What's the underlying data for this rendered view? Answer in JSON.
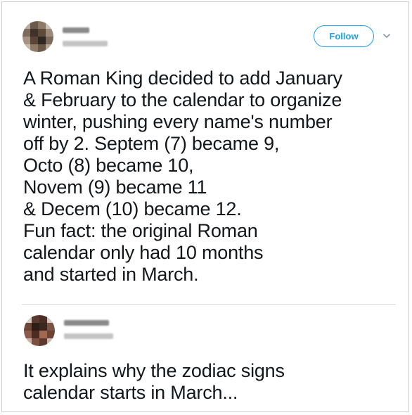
{
  "tweet": {
    "follow_label": "Follow",
    "text_lines": [
      "A Roman King decided to add January",
      "& February to the calendar to organize",
      "winter, pushing every name's number",
      "off by 2. Septem (7) became 9,",
      "Octo (8) became 10,",
      "Novem (9) became 11",
      "& Decem (10) became 12.",
      "Fun fact: the original Roman",
      "calendar only had 10 months",
      "and started in March."
    ]
  },
  "reply": {
    "text_lines": [
      "It explains why the zodiac signs",
      "calendar starts in March..."
    ]
  },
  "colors": {
    "accent": "#1da1f2",
    "text": "#14171a",
    "divider": "#dadada"
  }
}
